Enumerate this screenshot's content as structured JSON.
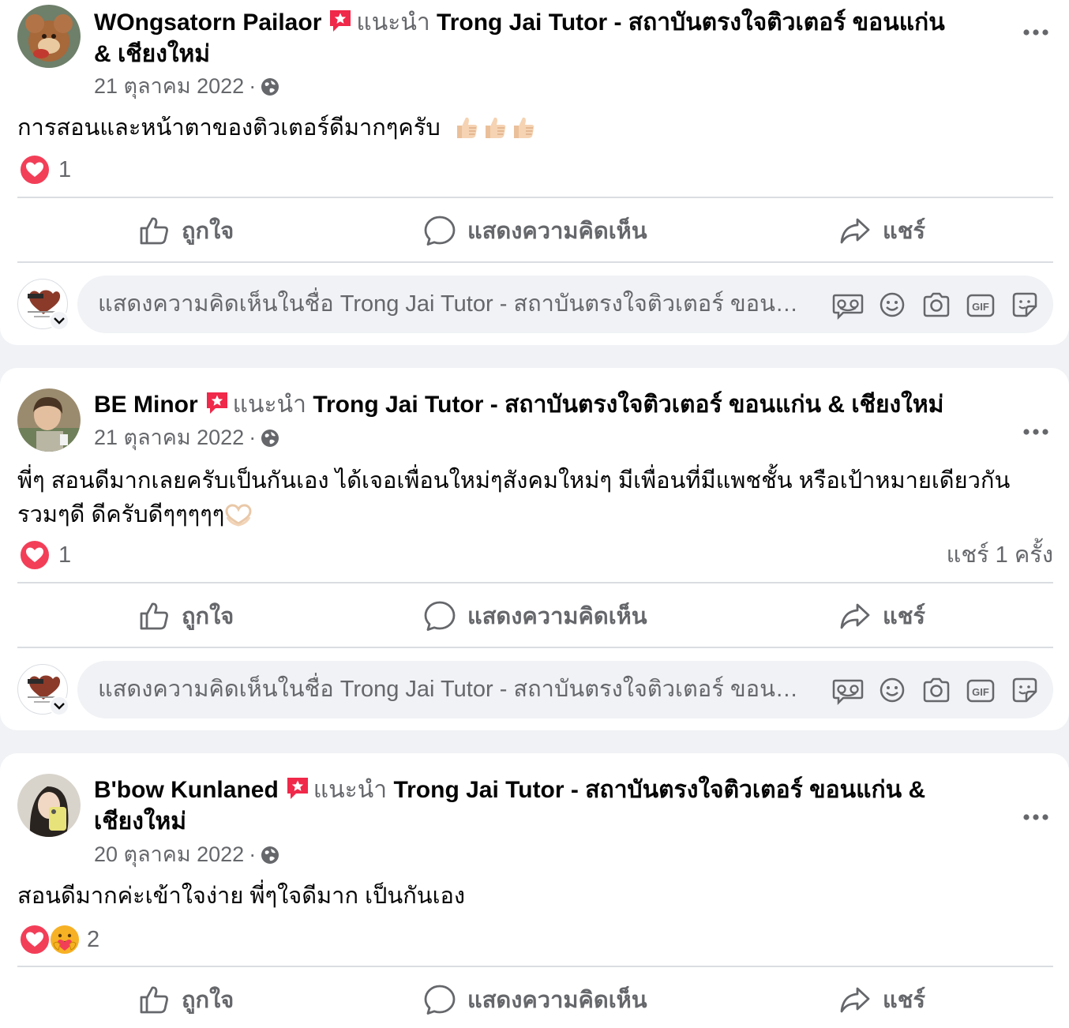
{
  "common": {
    "recommend_word": "แนะนำ",
    "page_name": "Trong Jai Tutor - สถาบันตรงใจติวเตอร์ ขอนแก่น & เชียงใหม่",
    "meta_dot": "·",
    "actions": {
      "like": "ถูกใจ",
      "comment": "แสดงความคิดเห็น",
      "share": "แชร์"
    },
    "composer_placeholder": "แสดงความคิดเห็นในชื่อ Trong Jai Tutor - สถาบันตรงใจติวเตอร์ ขอนแ...",
    "colors": {
      "background": "#F0F2F5",
      "card": "#FFFFFF",
      "secondary_text": "#65676B",
      "love_red": "#F33E58",
      "recommend_badge": "#F02849",
      "divider": "#DADDE1"
    }
  },
  "posts": [
    {
      "author": "WOngsatorn Pailaor",
      "date": "21 ตุลาคม 2022",
      "text": "การสอนและหน้าตาของติวเตอร์ดีมากๆครับ",
      "emoji": [
        "thumbs-up",
        "thumbs-up",
        "thumbs-up"
      ],
      "reactions": [
        "love"
      ],
      "reaction_count": "1",
      "share_count": ""
    },
    {
      "author": "BE Minor",
      "date": "21 ตุลาคม 2022",
      "text_line1": "พี่ๆ สอนดีมากเลยครับเป็นกันเอง ได้เจอเพื่อนใหม่ๆสังคมใหม่ๆ มีเพื่อนที่มีแพชชั้น หรือเป้าหมายเดียวกัน",
      "text_line2": "รวมๆดี ดีครับดีๆๆๆๆๆ",
      "emoji": [
        "heart-hands"
      ],
      "reactions": [
        "love"
      ],
      "reaction_count": "1",
      "share_count": "แชร์ 1 ครั้ง"
    },
    {
      "author": "B'bow Kunlaned",
      "date": "20 ตุลาคม 2022",
      "text": "สอนดีมากค่ะเข้าใจง่าย พี่ๆใจดีมาก เป็นกันเอง",
      "emoji": [],
      "reactions": [
        "love",
        "care"
      ],
      "reaction_count": "2",
      "share_count": ""
    }
  ]
}
